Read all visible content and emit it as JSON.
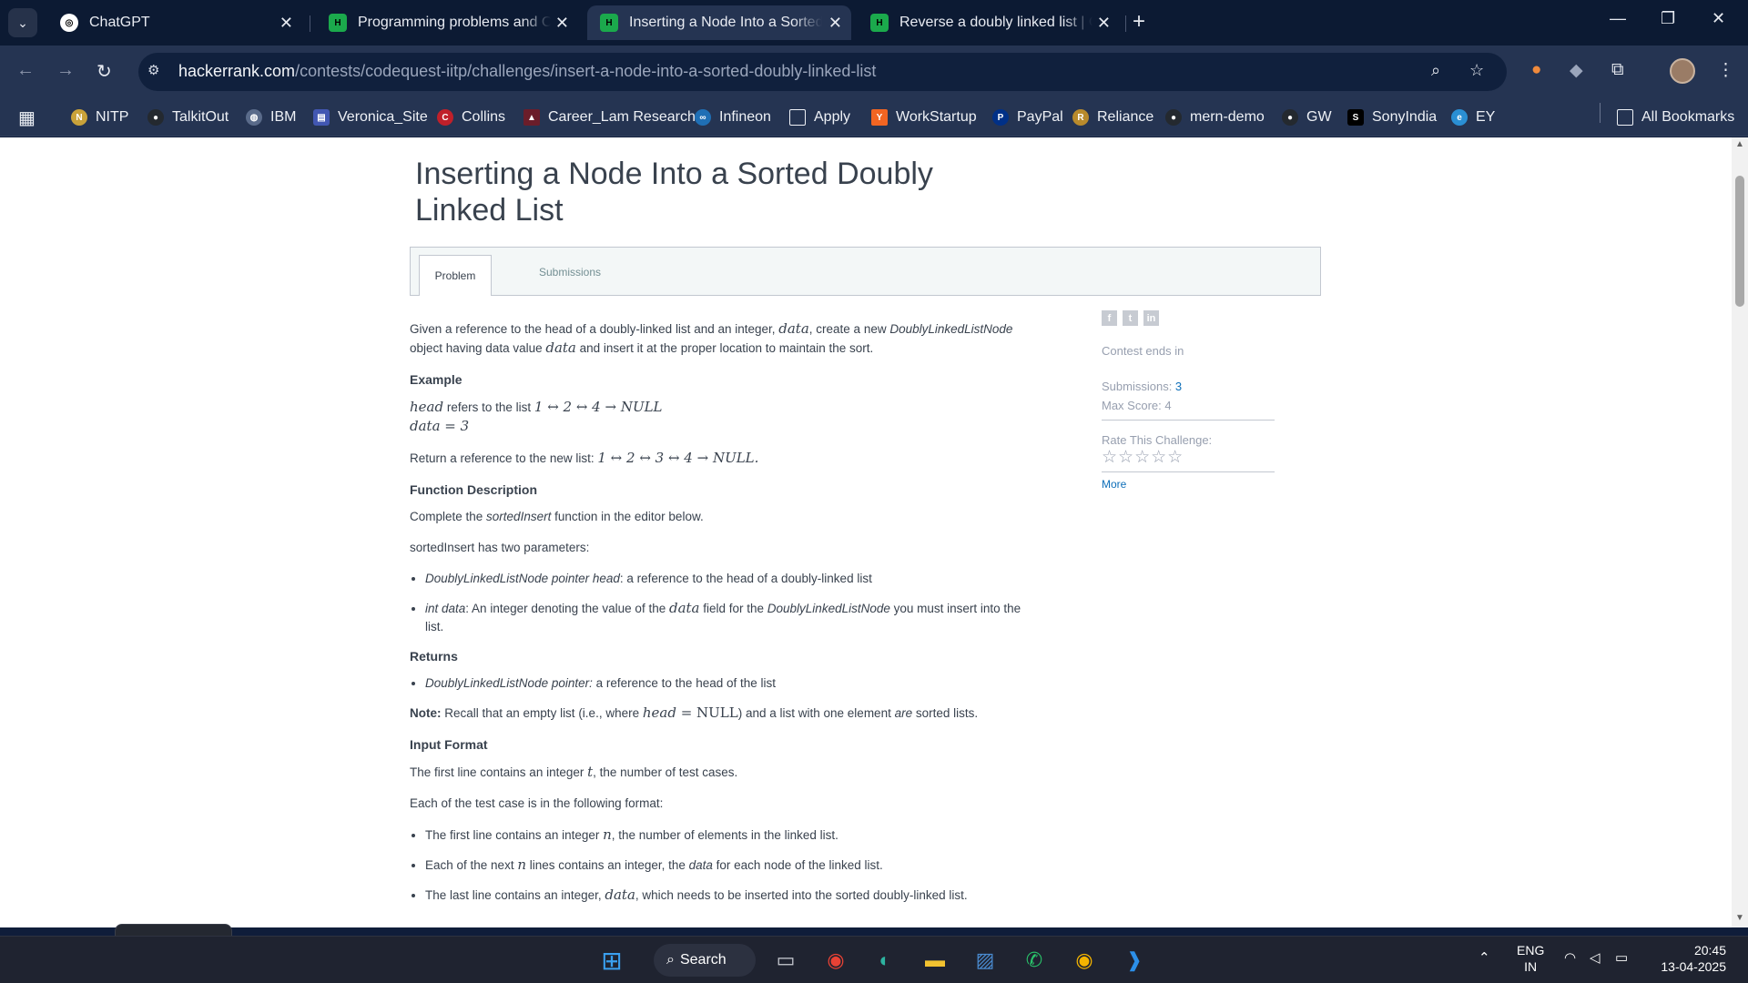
{
  "browser": {
    "tabs": [
      {
        "title": "ChatGPT",
        "favicon": "openai-icon"
      },
      {
        "title": "Programming problems and Co",
        "favicon": "hackerrank-icon"
      },
      {
        "title": "Inserting a Node Into a Sorted D",
        "favicon": "hackerrank-icon"
      },
      {
        "title": "Reverse a doubly linked list | Co",
        "favicon": "hackerrank-icon"
      }
    ],
    "url_domain": "hackerrank.com",
    "url_path": "/contests/codequest-iitp/challenges/insert-a-node-into-a-sorted-doubly-linked-list",
    "bookmarks": [
      "NITP",
      "TalkitOut",
      "IBM",
      "Veronica_Site",
      "Collins",
      "Career_Lam Research",
      "Infineon",
      "Apply",
      "WorkStartup",
      "PayPal",
      "Reliance",
      "mern-demo",
      "GW",
      "SonyIndia",
      "EY"
    ],
    "all_bookmarks": "All Bookmarks"
  },
  "page": {
    "title": "Inserting a Node Into a Sorted Doubly Linked List",
    "tabs": {
      "problem": "Problem",
      "submissions": "Submissions"
    },
    "intro_1": "Given a reference to the head of a doubly-linked list and an integer, ",
    "intro_data": "data",
    "intro_2": ", create a new ",
    "intro_node": "DoublyLinkedListNode",
    "intro_3": " object having data value ",
    "intro_4": " and insert it at the proper location to maintain the sort.",
    "example_heading": "Example",
    "ex_head": "head",
    "ex_refers": " refers to the list ",
    "ex_list": "1 ↔ 2 ↔ 4 → NULL",
    "ex_data": "data = 3",
    "return_text": "Return a reference to the new list: ",
    "return_list": "1 ↔ 2 ↔ 3 ↔ 4 → NULL.",
    "fd_heading": "Function Description",
    "fd_1": "Complete the ",
    "fd_fn": "sortedInsert",
    "fd_2": " function in the editor below.",
    "params_intro": "sortedInsert has two parameters:",
    "param1_name": "DoublyLinkedListNode pointer head",
    "param1_desc": ": a reference to the head of a doubly-linked list",
    "param2_name": "int data",
    "param2_desc_1": ": An integer denoting the value of the ",
    "param2_field": "data",
    "param2_desc_2": " field for the ",
    "param2_node": "DoublyLinkedListNode",
    "param2_desc_3": " you must insert into the list.",
    "returns_heading": "Returns",
    "returns_name": "DoublyLinkedListNode pointer:",
    "returns_desc": " a reference to the head of the list",
    "note_label": "Note:",
    "note_1": " Recall that an empty list (i.e., where ",
    "note_head": "head",
    "note_eq": " = NULL",
    "note_2": ") and a list with one element ",
    "note_are": "are",
    "note_3": " sorted lists.",
    "input_heading": "Input Format",
    "input_1a": "The first line contains an integer ",
    "input_t": "t",
    "input_1b": ", the number of test cases.",
    "input_2": "Each of the test case is in the following format:",
    "in_li1a": "The first line contains an integer ",
    "in_n": "n",
    "in_li1b": ", the number of elements in the linked list.",
    "in_li2a": "Each of the next ",
    "in_li2b": " lines contains an integer, the ",
    "in_li2data": "data",
    "in_li2c": " for each node of the linked list.",
    "in_li3a": "The last line contains an integer, ",
    "in_li3data": "data",
    "in_li3b": ", which needs to be inserted into the sorted doubly-linked list."
  },
  "sidebar": {
    "contest_ends": "Contest ends in",
    "submissions_label": "Submissions: ",
    "submissions_value": "3",
    "max_score": "Max Score: 4",
    "rate": "Rate This Challenge:",
    "stars": "☆☆☆☆☆",
    "more": "More"
  },
  "taskbar": {
    "search": "Search",
    "lang": "ENG",
    "region": "IN",
    "time": "20:45",
    "date": "13-04-2025"
  }
}
